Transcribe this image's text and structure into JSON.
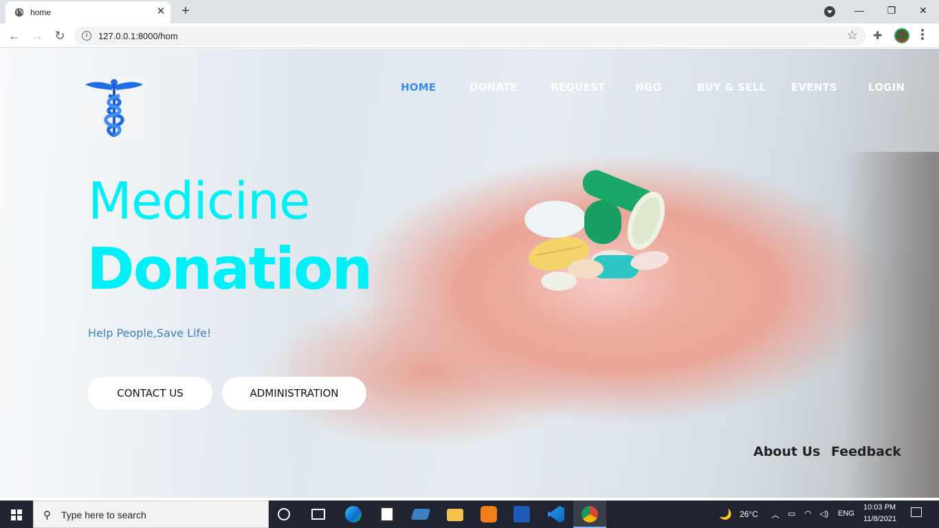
{
  "browser": {
    "tab_title": "home",
    "url": "127.0.0.1:8000/hom"
  },
  "site": {
    "nav": [
      "HOME",
      "DONATE",
      "REQUEST",
      "NGO",
      "BUY & SELL",
      "EVENTS",
      "LOGIN"
    ],
    "active_nav": "HOME",
    "hero_line1": "Medicine",
    "hero_line2": "Donation",
    "tagline": "Help People,Save Life!",
    "buttons": {
      "contact": "CONTACT US",
      "admin": "ADMINISTRATION"
    },
    "footer_links": {
      "about": "About Us",
      "feedback": "Feedback"
    },
    "colors": {
      "accent": "#00f0f8",
      "nav_active": "#3b8ee8",
      "tagline": "#3b7fc4"
    }
  },
  "taskbar": {
    "search_placeholder": "Type here to search",
    "weather": "26°C",
    "language": "ENG",
    "time": "10:03 PM",
    "date": "11/8/2021"
  }
}
